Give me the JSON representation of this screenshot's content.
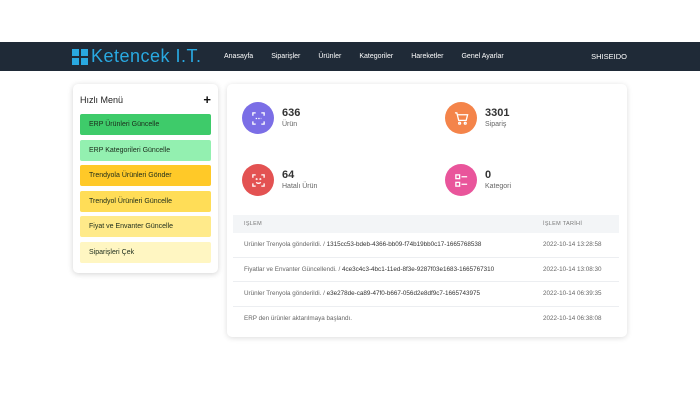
{
  "header": {
    "logo_text": "Ketencek I.T.",
    "nav": [
      "Anasayfa",
      "Siparişler",
      "Ürünler",
      "Kategoriler",
      "Hareketler",
      "Genel Ayarlar"
    ],
    "store_name": "SHISEIDO"
  },
  "quick_menu": {
    "title": "Hızlı Menü",
    "items": [
      {
        "label": "ERP Ürünleri Güncelle",
        "color": "#3ecb6a"
      },
      {
        "label": "ERP Kategorileri Güncelle",
        "color": "#93f0b0"
      },
      {
        "label": "Trendyola Ürünleri Gönder",
        "color": "#ffc928"
      },
      {
        "label": "Trendyol Ürünleri Güncelle",
        "color": "#ffdd57"
      },
      {
        "label": "Fiyat ve Envanter Güncelle",
        "color": "#ffea8a"
      },
      {
        "label": "Siparişleri Çek",
        "color": "#fff6c2"
      }
    ]
  },
  "stats": [
    {
      "value": "636",
      "label": "Ürün",
      "color": "#7b6ee6",
      "icon": "scan-icon"
    },
    {
      "value": "3301",
      "label": "Sipariş",
      "color": "#f4844a",
      "icon": "cart-icon"
    },
    {
      "value": "64",
      "label": "Hatalı Ürün",
      "color": "#e35252",
      "icon": "face-scan-icon"
    },
    {
      "value": "0",
      "label": "Kategori",
      "color": "#e9559b",
      "icon": "list-icon"
    }
  ],
  "log": {
    "col_action": "İŞLEM",
    "col_date": "İŞLEM TARİHİ",
    "rows": [
      {
        "text": "Ürünler Trenyola gönderildi. / ",
        "id": "1315cc53-bdeb-4366-bb09-f74b19bb0c17-1665768538",
        "date": "2022-10-14 13:28:58"
      },
      {
        "text": "Fiyatlar ve Envanter Güncellendi. / ",
        "id": "4ce3c4c3-4bc1-11ed-8f3e-9287f03e1683-1665767310",
        "date": "2022-10-14 13:08:30"
      },
      {
        "text": "Ürünler Trenyola gönderildi. / ",
        "id": "e3e278de-ca89-47f0-b667-056d2e8df9c7-1665743975",
        "date": "2022-10-14 06:39:35"
      },
      {
        "text": "ERP den ürünler aktarılmaya başlandı.",
        "id": "",
        "date": "2022-10-14 06:38:08"
      }
    ]
  }
}
